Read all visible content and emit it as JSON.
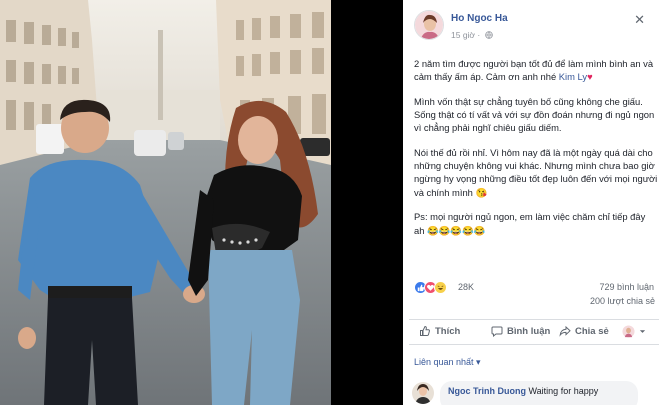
{
  "post": {
    "author": "Ho Ngoc Ha",
    "time": "15 giờ",
    "paragraph1_pre": "2 năm tìm được người bạn tốt đủ để làm mình bình an và cảm thấy ấm áp. Cảm ơn anh nhé ",
    "paragraph1_mention": "Kim Ly",
    "paragraph1_heart": "♥",
    "paragraph2": "Mình vốn thật sự chẳng tuyên bố cũng không che giấu. Sống thật có tí vất vả với sự đồn đoán nhưng đi ngủ ngon vì chẳng phải nghĩ chiêu giấu diếm.",
    "paragraph3": "Nói thế đủ rồi nhỉ. Vì hôm nay đã là một ngày quá dài cho những chuyện không vui khác. Nhưng mình chưa bao giờ ngừng hy vọng những điều tốt đẹp luôn đến với mọi người và chính mình 😘",
    "paragraph4": "Ps: mọi người ngủ ngon, em làm việc chăm chỉ tiếp đây ah 😂😂😂😂😂"
  },
  "stats": {
    "reactions": "28K",
    "comments": "729 bình luận",
    "shares": "200 lượt chia sẻ"
  },
  "actions": {
    "like": "Thích",
    "comment": "Bình luận",
    "share": "Chia sẻ"
  },
  "comments_filter": "Liên quan nhất ▾",
  "comment": {
    "author": "Ngoc Trinh Duong",
    "text": "Waiting for happy"
  },
  "colors": {
    "link": "#385898",
    "text": "#1d2129",
    "muted": "#90949c",
    "like_reaction": "#3b7aeb",
    "love_reaction": "#f0506e",
    "haha_reaction": "#f7d04b"
  }
}
